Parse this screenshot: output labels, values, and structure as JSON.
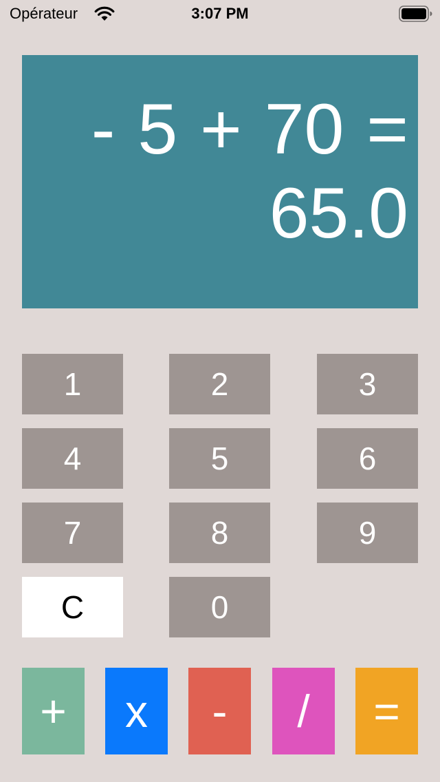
{
  "status_bar": {
    "carrier": "Opérateur",
    "time": "3:07 PM",
    "wifi_icon": "wifi-icon",
    "battery_icon": "battery-icon"
  },
  "display": {
    "expression": "- 5 + 70 =",
    "result": "65.0",
    "background_color": "#418896"
  },
  "keypad": {
    "digits": {
      "one": "1",
      "two": "2",
      "three": "3",
      "four": "4",
      "five": "5",
      "six": "6",
      "seven": "7",
      "eight": "8",
      "nine": "9",
      "zero": "0"
    },
    "clear": "C"
  },
  "operators": {
    "plus": "+",
    "multiply": "x",
    "minus": "-",
    "divide": "/",
    "equals": "="
  },
  "colors": {
    "background": "#e0d8d6",
    "digit_key": "#9e9592",
    "clear_key": "#ffffff",
    "plus": "#7bb79d",
    "multiply": "#0a79fc",
    "minus": "#e06152",
    "divide": "#de54bd",
    "equals": "#f1a424"
  }
}
